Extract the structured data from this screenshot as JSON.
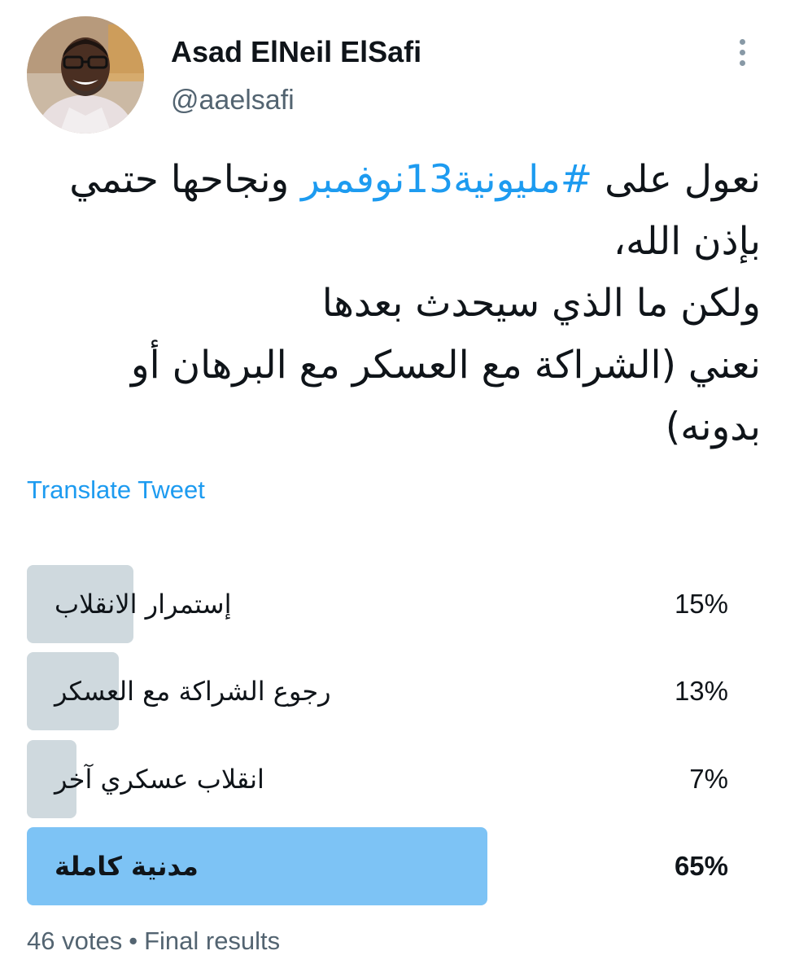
{
  "author": {
    "display_name": "Asad ElNeil ElSafi",
    "handle": "@aaelsafi"
  },
  "tweet": {
    "text_before": "نعول على ",
    "hashtag": "#مليونية13نوفمبر",
    "text_after": " ونجاحها حتمي بإذن الله،",
    "line_2": "ولكن ما الذي سيحدث بعدها",
    "line_3": "نعني  (الشراكة مع العسكر مع البرهان أو بدونه)"
  },
  "translate_label": "Translate Tweet",
  "poll": {
    "options": [
      {
        "label": "إستمرار الانقلاب",
        "percent_text": "15%",
        "share": 0.15,
        "winner": false
      },
      {
        "label": "رجوع الشراكة مع العسكر",
        "percent_text": "13%",
        "share": 0.13,
        "winner": false
      },
      {
        "label": "انقلاب عسكري آخر",
        "percent_text": "7%",
        "share": 0.07,
        "winner": false
      },
      {
        "label": "مدنية كاملة",
        "percent_text": "65%",
        "share": 0.65,
        "winner": true
      }
    ],
    "votes": "46 votes",
    "separator": "•",
    "status": "Final results"
  },
  "colors": {
    "accent": "#1d9bf0",
    "poll_bar": "#cfd9de",
    "poll_bar_winner": "#7dc3f5",
    "secondary_text": "#536471"
  },
  "icons": {
    "more": "more-vertical-icon"
  }
}
